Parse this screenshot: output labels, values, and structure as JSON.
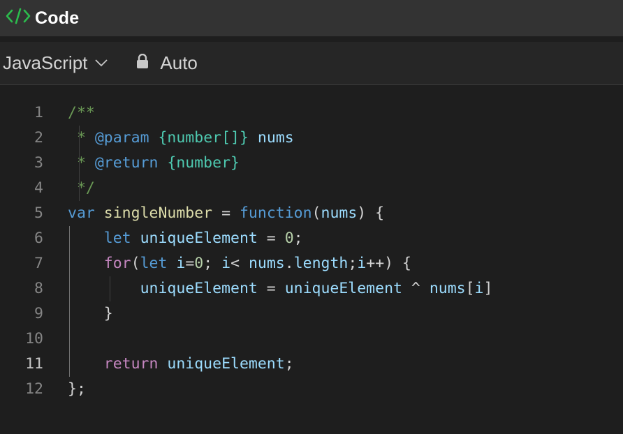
{
  "header": {
    "title": "Code",
    "icon": "code-brackets-icon"
  },
  "toolbar": {
    "language": "JavaScript",
    "mode": "Auto"
  },
  "editor": {
    "active_line": 11,
    "lines": [
      {
        "n": "1"
      },
      {
        "n": "2"
      },
      {
        "n": "3"
      },
      {
        "n": "4"
      },
      {
        "n": "5"
      },
      {
        "n": "6"
      },
      {
        "n": "7"
      },
      {
        "n": "8"
      },
      {
        "n": "9"
      },
      {
        "n": "10"
      },
      {
        "n": "11"
      },
      {
        "n": "12"
      }
    ],
    "code": [
      [
        {
          "t": "/**",
          "c": "c-comment"
        }
      ],
      [
        {
          "t": " * ",
          "c": "c-comment"
        },
        {
          "t": "@param",
          "c": "c-jsdoc-tag"
        },
        {
          "t": " ",
          "c": "c-comment"
        },
        {
          "t": "{number[]}",
          "c": "c-type"
        },
        {
          "t": " ",
          "c": "c-comment"
        },
        {
          "t": "nums",
          "c": "c-var"
        }
      ],
      [
        {
          "t": " * ",
          "c": "c-comment"
        },
        {
          "t": "@return",
          "c": "c-jsdoc-tag"
        },
        {
          "t": " ",
          "c": "c-comment"
        },
        {
          "t": "{number}",
          "c": "c-type"
        }
      ],
      [
        {
          "t": " */",
          "c": "c-comment"
        }
      ],
      [
        {
          "t": "var",
          "c": "c-keyword"
        },
        {
          "t": " ",
          "c": "c-op"
        },
        {
          "t": "singleNumber",
          "c": "c-func"
        },
        {
          "t": " = ",
          "c": "c-op"
        },
        {
          "t": "function",
          "c": "c-keyword"
        },
        {
          "t": "(",
          "c": "c-bracket"
        },
        {
          "t": "nums",
          "c": "c-var"
        },
        {
          "t": ") {",
          "c": "c-bracket"
        }
      ],
      [
        {
          "t": "    ",
          "c": "c-op"
        },
        {
          "t": "let",
          "c": "c-keyword"
        },
        {
          "t": " ",
          "c": "c-op"
        },
        {
          "t": "uniqueElement",
          "c": "c-var"
        },
        {
          "t": " = ",
          "c": "c-op"
        },
        {
          "t": "0",
          "c": "c-num"
        },
        {
          "t": ";",
          "c": "c-op"
        }
      ],
      [
        {
          "t": "    ",
          "c": "c-op"
        },
        {
          "t": "for",
          "c": "c-control"
        },
        {
          "t": "(",
          "c": "c-bracket"
        },
        {
          "t": "let",
          "c": "c-keyword"
        },
        {
          "t": " ",
          "c": "c-op"
        },
        {
          "t": "i",
          "c": "c-var"
        },
        {
          "t": "=",
          "c": "c-op"
        },
        {
          "t": "0",
          "c": "c-num"
        },
        {
          "t": "; ",
          "c": "c-op"
        },
        {
          "t": "i",
          "c": "c-var"
        },
        {
          "t": "< ",
          "c": "c-op"
        },
        {
          "t": "nums",
          "c": "c-var"
        },
        {
          "t": ".",
          "c": "c-op"
        },
        {
          "t": "length",
          "c": "c-var"
        },
        {
          "t": ";",
          "c": "c-op"
        },
        {
          "t": "i",
          "c": "c-var"
        },
        {
          "t": "++",
          "c": "c-op"
        },
        {
          "t": ") {",
          "c": "c-bracket"
        }
      ],
      [
        {
          "t": "        ",
          "c": "c-op"
        },
        {
          "t": "uniqueElement",
          "c": "c-var"
        },
        {
          "t": " = ",
          "c": "c-op"
        },
        {
          "t": "uniqueElement",
          "c": "c-var"
        },
        {
          "t": " ^ ",
          "c": "c-op"
        },
        {
          "t": "nums",
          "c": "c-var"
        },
        {
          "t": "[",
          "c": "c-bracket"
        },
        {
          "t": "i",
          "c": "c-var"
        },
        {
          "t": "]",
          "c": "c-bracket"
        }
      ],
      [
        {
          "t": "    ",
          "c": "c-op"
        },
        {
          "t": "}",
          "c": "c-bracket"
        }
      ],
      [],
      [
        {
          "t": "    ",
          "c": "c-op"
        },
        {
          "t": "return",
          "c": "c-control"
        },
        {
          "t": " ",
          "c": "c-op"
        },
        {
          "t": "uniqueElement",
          "c": "c-var"
        },
        {
          "t": ";",
          "c": "c-op"
        }
      ],
      [
        {
          "t": "};",
          "c": "c-bracket"
        }
      ]
    ]
  }
}
